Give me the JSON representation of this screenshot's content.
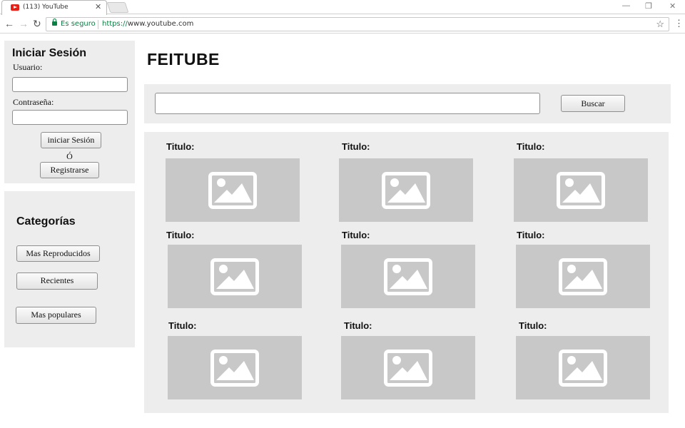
{
  "browser": {
    "tab_title": "(113) YouTube",
    "tab_close_icon": "close-icon",
    "secure_label": "Es seguro",
    "url_scheme": "https://",
    "url_rest": "www.youtube.com",
    "window_controls": [
      "minimize-icon",
      "restore-icon",
      "close-icon"
    ]
  },
  "login": {
    "title": "Iniciar Sesión",
    "username_label": "Usuario:",
    "username_value": "",
    "password_label": "Contraseña:",
    "password_value": "",
    "login_button": "iniciar Sesión",
    "or_text": "Ó",
    "register_button": "Registrarse"
  },
  "categories": {
    "title": "Categorías",
    "items": [
      "Mas Reproducidos",
      "Recientes",
      "Mas populares"
    ]
  },
  "header": {
    "logo": "FEITUBE"
  },
  "search": {
    "value": "",
    "button": "Buscar"
  },
  "videos": [
    {
      "title": "Titulo:"
    },
    {
      "title": "Titulo:"
    },
    {
      "title": "Titulo:"
    },
    {
      "title": "Titulo:"
    },
    {
      "title": "Titulo:"
    },
    {
      "title": "Titulo:"
    },
    {
      "title": "Titulo:"
    },
    {
      "title": "Titulo:"
    },
    {
      "title": "Titulo:"
    }
  ],
  "colors": {
    "panel_bg": "#ededed",
    "thumb_bg": "#c8c8c8",
    "secure_green": "#0b8043",
    "favicon_red": "#e62117"
  }
}
